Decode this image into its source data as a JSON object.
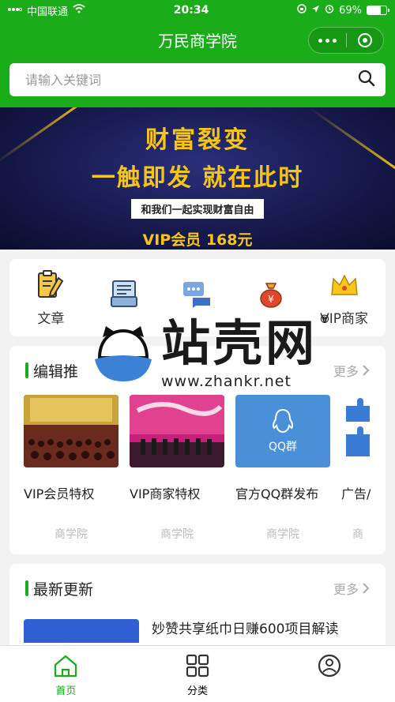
{
  "status_bar": {
    "carrier": "中国联通",
    "time": "20:34",
    "battery_percent": "69%",
    "battery_level": 0.69
  },
  "nav": {
    "title": "万民商学院"
  },
  "search": {
    "placeholder": "请输入关键词"
  },
  "banner": {
    "line1": "财富裂变",
    "line2": "一触即发 就在此时",
    "line3": "和我们一起实现财富自由",
    "line4": "VIP会员 168元"
  },
  "quick_links": [
    {
      "label": "文章",
      "icon": "document-pen-icon"
    },
    {
      "label": "",
      "icon": "newspaper-icon"
    },
    {
      "label": "",
      "icon": "chat-bubbles-icon"
    },
    {
      "label": "",
      "icon": "money-bag-icon"
    },
    {
      "label": "VIP商家",
      "icon": "crown-icon"
    }
  ],
  "editor_section": {
    "title": "编辑推",
    "more": "更多",
    "items": [
      {
        "title": "VIP会员特权",
        "category": "商学院"
      },
      {
        "title": "VIP商家特权",
        "category": "商学院"
      },
      {
        "title": "官方QQ群发布",
        "category": "商学院",
        "thumb_text": "QQ群"
      },
      {
        "title": "广告/",
        "category": "商"
      }
    ]
  },
  "latest_section": {
    "title": "最新更新",
    "more": "更多",
    "first_item_title": "妙赞共享纸巾日赚600项目解读"
  },
  "tabbar": {
    "home": "首页",
    "category": "分类"
  },
  "watermark": {
    "brand": "站壳网",
    "registered": "®",
    "url": "www.zhankr.net"
  },
  "colors": {
    "brand_green": "#1aad19",
    "banner_gold": "#f5c518",
    "qq_blue": "#4a90d9"
  }
}
